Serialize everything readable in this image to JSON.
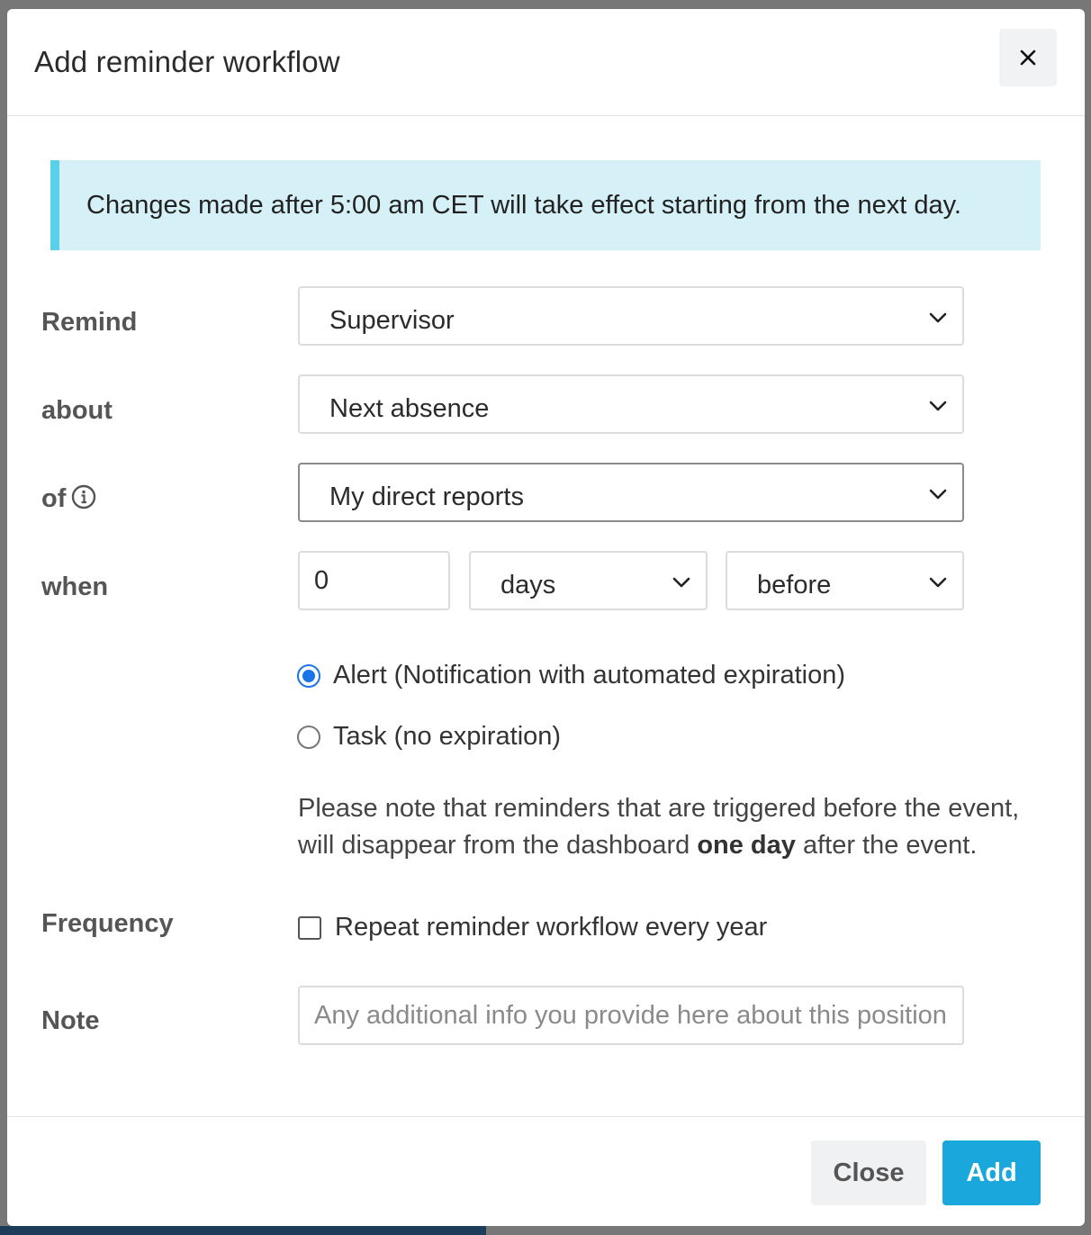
{
  "dialog": {
    "title": "Add reminder workflow"
  },
  "banner": {
    "text": "Changes made after 5:00 am CET will take effect starting from the next day."
  },
  "form": {
    "remind": {
      "label": "Remind",
      "value": "Supervisor"
    },
    "about": {
      "label": "about",
      "value": "Next absence"
    },
    "of": {
      "label": "of",
      "value": "My direct reports"
    },
    "when": {
      "label": "when",
      "amount": "0",
      "unit": "days",
      "relation": "before"
    },
    "reminder_type": {
      "options": [
        {
          "label": "Alert (Notification with automated expiration)",
          "checked": true
        },
        {
          "label": "Task (no expiration)",
          "checked": false
        }
      ]
    },
    "notice": {
      "part1": "Please note that reminders that are triggered before the event, will disappear from the dashboard ",
      "bold": "one day",
      "part2": " after the event."
    },
    "frequency": {
      "label": "Frequency",
      "checkbox_label": "Repeat reminder workflow every year",
      "checked": false
    },
    "note": {
      "label": "Note",
      "placeholder": "Any additional info you provide here about this position"
    }
  },
  "footer": {
    "close_label": "Close",
    "add_label": "Add"
  },
  "colors": {
    "accent": "#1aa7dc",
    "banner_bg": "#d6f0f7",
    "banner_border": "#5bd0ea",
    "radio_checked": "#1a73e8"
  },
  "icons": {
    "close": "close-icon",
    "chevron": "chevron-down-icon",
    "info": "info-icon"
  }
}
